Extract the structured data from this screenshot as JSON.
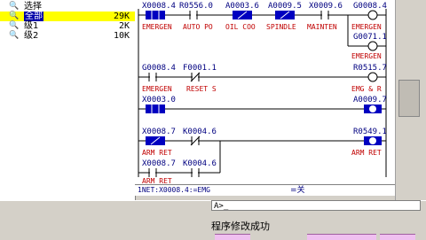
{
  "tree": {
    "items": [
      {
        "label": "选择",
        "size": "",
        "selected": false
      },
      {
        "label": "全部",
        "size": "29K",
        "selected": true
      },
      {
        "label": "级1",
        "size": "2K",
        "selected": false
      },
      {
        "label": "级2",
        "size": "10K",
        "selected": false
      }
    ]
  },
  "ladder": {
    "rung1": {
      "contacts": [
        "X0008.4",
        "R0556.0",
        "A0003.6",
        "A0009.5",
        "X0009.6"
      ],
      "coil": "G0008.4",
      "comments": [
        "EMERGEN",
        "AUTO PO",
        "OIL COO",
        "SPINDLE",
        "MAINTEN"
      ],
      "coil_comment": "EMERGEN",
      "branch_coil": "G0071.1"
    },
    "rung1_coil_comment2": "EMERGEN",
    "rung2": {
      "contacts": [
        "G0008.4",
        "F0001.1"
      ],
      "coil": "R0515.7",
      "comments": [
        "EMERGEN",
        "RESET S"
      ],
      "coil_comment": "EMG & R",
      "branch_contact": "X0003.0",
      "branch_coil": "A0009.7"
    },
    "rung3": {
      "contacts": [
        "X0008.7",
        "K0004.6"
      ],
      "coil": "R0549.1",
      "comment": "ARM RET",
      "coil_comment": "ARM RET",
      "branch_contacts": [
        "X0008.7",
        "K0004.6"
      ],
      "branch_comment": "ARM RET"
    }
  },
  "netline": {
    "net": "1NET:X0008.4:=EMG",
    "value": "=关"
  },
  "command": {
    "prompt": "A>_"
  },
  "message": "程序修改成功",
  "colors": {
    "selected_bg": "#0000a8",
    "highlight_row": "#ffff00",
    "address": "#000080",
    "comment": "#c00000",
    "contact_active": "#0000c0"
  }
}
